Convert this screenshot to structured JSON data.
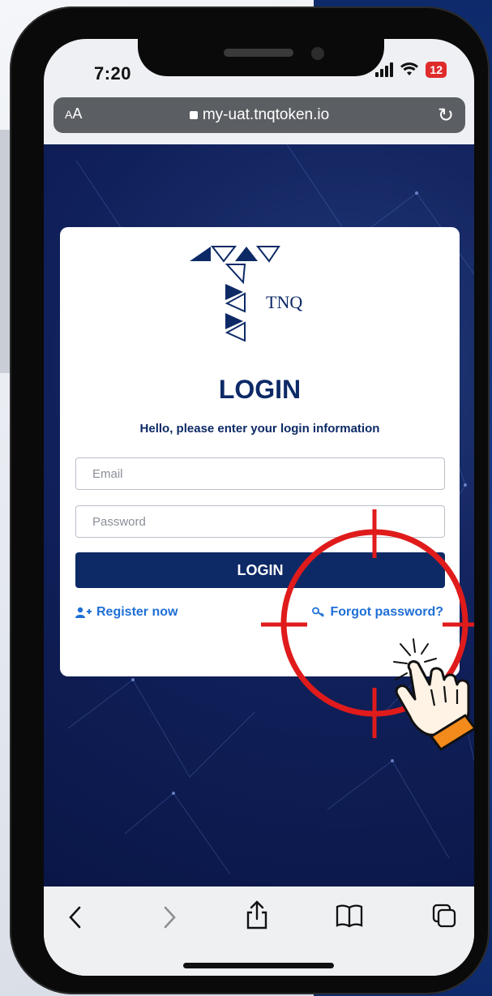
{
  "status_bar": {
    "time": "7:20",
    "battery": "12"
  },
  "browser": {
    "text_size": "AA",
    "url": "my-uat.tnqtoken.io"
  },
  "login_form": {
    "brand": "TNQ",
    "title": "LOGIN",
    "subtitle": "Hello, please enter your login information",
    "email_placeholder": "Email",
    "password_placeholder": "Password",
    "login_button": "LOGIN",
    "register_link": "Register now",
    "forgot_link": "Forgot password?"
  },
  "toolbar": {
    "back_icon": "chevron-left",
    "forward_icon": "chevron-right",
    "share_icon": "share",
    "bookmarks_icon": "book",
    "tabs_icon": "tabs"
  },
  "colors": {
    "navy": "#0d2a66",
    "link_blue": "#1f6fd6",
    "highlight_red": "#e01b1b",
    "page_background": "#10205a"
  }
}
